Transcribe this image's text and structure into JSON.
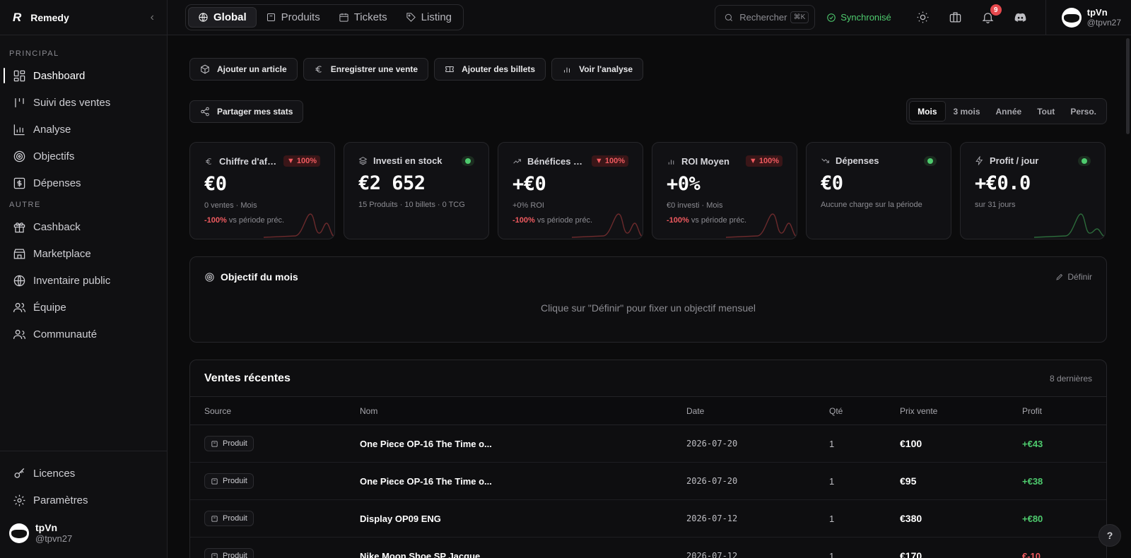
{
  "brand": {
    "logo": "R",
    "name": "Remedy",
    "collapse": "‹"
  },
  "sidebar": {
    "principal_label": "PRINCIPAL",
    "principal": [
      {
        "label": "Dashboard",
        "icon": "dashboard-icon"
      },
      {
        "label": "Suivi des ventes",
        "icon": "sales-tracking-icon"
      },
      {
        "label": "Analyse",
        "icon": "chart-icon"
      },
      {
        "label": "Objectifs",
        "icon": "target-icon"
      },
      {
        "label": "Dépenses",
        "icon": "dollar-icon"
      }
    ],
    "other_label": "AUTRE",
    "other": [
      {
        "label": "Cashback",
        "icon": "gift-icon"
      },
      {
        "label": "Marketplace",
        "icon": "store-icon"
      },
      {
        "label": "Inventaire public",
        "icon": "globe-icon"
      },
      {
        "label": "Équipe",
        "icon": "team-icon"
      },
      {
        "label": "Communauté",
        "icon": "community-icon"
      }
    ],
    "bottom": [
      {
        "label": "Licences",
        "icon": "key-icon"
      },
      {
        "label": "Paramètres",
        "icon": "gear-icon"
      }
    ],
    "user": {
      "name": "tpVn",
      "handle": "@tpvn27"
    }
  },
  "topbar": {
    "tabs": [
      {
        "label": "Global",
        "icon": "globe-icon"
      },
      {
        "label": "Produits",
        "icon": "package-icon"
      },
      {
        "label": "Tickets",
        "icon": "calendar-icon"
      },
      {
        "label": "Listing",
        "icon": "tag-icon"
      }
    ],
    "search_placeholder": "Rechercher",
    "search_shortcut": "⌘K",
    "sync_status": "Synchronisé",
    "notifications": "9",
    "user": {
      "name": "tpVn",
      "handle": "@tpvn27"
    }
  },
  "actions": [
    {
      "label": "Ajouter un article",
      "icon": "box-icon"
    },
    {
      "label": "Enregistrer une vente",
      "icon": "euro-icon"
    },
    {
      "label": "Ajouter des billets",
      "icon": "ticket-icon"
    },
    {
      "label": "Voir l'analyse",
      "icon": "bar-chart-icon"
    }
  ],
  "share_label": "Partager mes stats",
  "periods": [
    "Mois",
    "3 mois",
    "Année",
    "Tout",
    "Perso."
  ],
  "stats": [
    {
      "label": "Chiffre d'affaires",
      "icon": "euro-icon",
      "change": "▼ 100%",
      "value": "€0",
      "sub": "0 ventes · Mois",
      "cmp_value": "-100%",
      "cmp_text": " vs période préc.",
      "spark": "red"
    },
    {
      "label": "Investi en stock",
      "icon": "layers-icon",
      "dot": true,
      "value": "€2 652",
      "sub": "15 Produits · 10 billets · 0 TCG"
    },
    {
      "label": "Bénéfices nets",
      "icon": "trend-up-icon",
      "change": "▼ 100%",
      "value": "+€0",
      "sub": "+0% ROI",
      "cmp_value": "-100%",
      "cmp_text": " vs période préc.",
      "spark": "red"
    },
    {
      "label": "ROI Moyen",
      "icon": "bar-chart-icon",
      "change": "▼ 100%",
      "value": "+0%",
      "sub": "€0 investi · Mois",
      "cmp_value": "-100%",
      "cmp_text": " vs période préc.",
      "spark": "red"
    },
    {
      "label": "Dépenses",
      "icon": "trend-down-icon",
      "dot": true,
      "value": "€0",
      "sub": "Aucune charge sur la période"
    },
    {
      "label": "Profit / jour",
      "icon": "bolt-icon",
      "dot": true,
      "value": "+€0.0",
      "sub": "sur 31 jours",
      "spark": "green"
    }
  ],
  "objective": {
    "title": "Objectif du mois",
    "define": "Définir",
    "empty": "Clique sur \"Définir\" pour fixer un objectif mensuel"
  },
  "sales": {
    "title": "Ventes récentes",
    "count": "8 dernières",
    "columns": [
      "Source",
      "Nom",
      "Date",
      "Qté",
      "Prix vente",
      "Profit"
    ],
    "rows": [
      {
        "source": "Produit",
        "name": "One Piece OP-16 The Time o...",
        "date": "2026-07-20",
        "qty": "1",
        "price": "€100",
        "profit": "+€43",
        "profit_sign": "pos"
      },
      {
        "source": "Produit",
        "name": "One Piece OP-16 The Time o...",
        "date": "2026-07-20",
        "qty": "1",
        "price": "€95",
        "profit": "+€38",
        "profit_sign": "pos"
      },
      {
        "source": "Produit",
        "name": "Display OP09 ENG",
        "date": "2026-07-12",
        "qty": "1",
        "price": "€380",
        "profit": "+€80",
        "profit_sign": "pos"
      },
      {
        "source": "Produit",
        "name": "Nike Moon Shoe SP Jacque...",
        "date": "2026-07-12",
        "qty": "1",
        "price": "€170",
        "profit": "€-10",
        "profit_sign": "neg"
      }
    ]
  },
  "help": "?",
  "colors": {
    "accent_green": "#4ecb6e",
    "accent_red": "#ef5a5f",
    "background": "#0b0b0c"
  }
}
